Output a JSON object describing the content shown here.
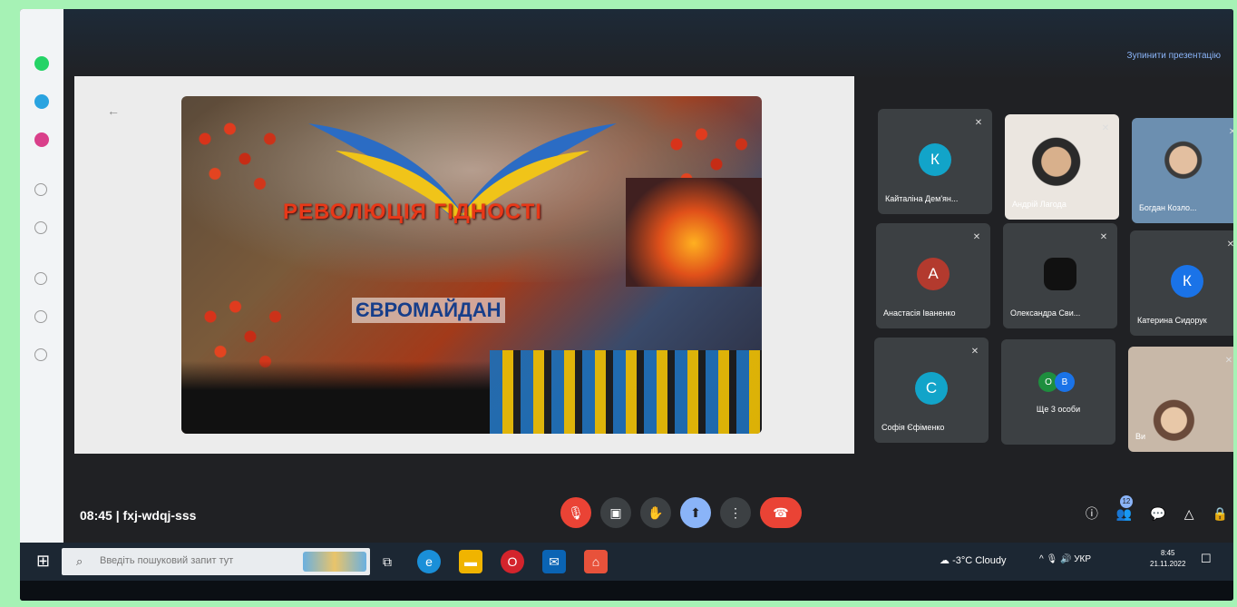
{
  "meet": {
    "stop_presenting": "Зупинити презентацію",
    "slide": {
      "title_line_1": "РЕВОЛЮЦІЯ    ГІДНОСТІ",
      "title_line_2": "ЄВРОМАЙДАН"
    },
    "participants": [
      {
        "name": "Кайталіна Дем'ян...",
        "initial": "К",
        "color": "#12a4c9",
        "video": false
      },
      {
        "name": "Андрій Лагода",
        "initial": "",
        "color": "",
        "video": true
      },
      {
        "name": "Богдан Козло...",
        "initial": "",
        "color": "",
        "video": true
      },
      {
        "name": "Анастасія Іваненко",
        "initial": "А",
        "color": "#b33a2e",
        "video": false
      },
      {
        "name": "Олександра Сви...",
        "initial": "",
        "color": "#111111",
        "video": false
      },
      {
        "name": "Катерина Сидорук",
        "initial": "К",
        "color": "#1a73e8",
        "video": false
      },
      {
        "name": "Софія Єфіменко",
        "initial": "С",
        "color": "#12a4c9",
        "video": false
      },
      {
        "name": "Ви",
        "initial": "",
        "color": "",
        "video": true
      }
    ],
    "more_people": {
      "label": "Ще 3 особи",
      "avatars": [
        {
          "initial": "О",
          "color": "#1e8e3e"
        },
        {
          "initial": "В",
          "color": "#1a73e8"
        }
      ]
    },
    "meeting_time": "08:45",
    "meeting_code": "fxj-wdqj-sss",
    "people_count": "12"
  },
  "taskbar": {
    "search_placeholder": "Введіть пошуковий запит тут",
    "weather": "-3°C  Cloudy",
    "language": "УКР",
    "time": "8:45",
    "date": "21.11.2022"
  },
  "colors": {
    "accent": "#8ab4f8",
    "danger": "#ea4335",
    "background": "#202124"
  }
}
